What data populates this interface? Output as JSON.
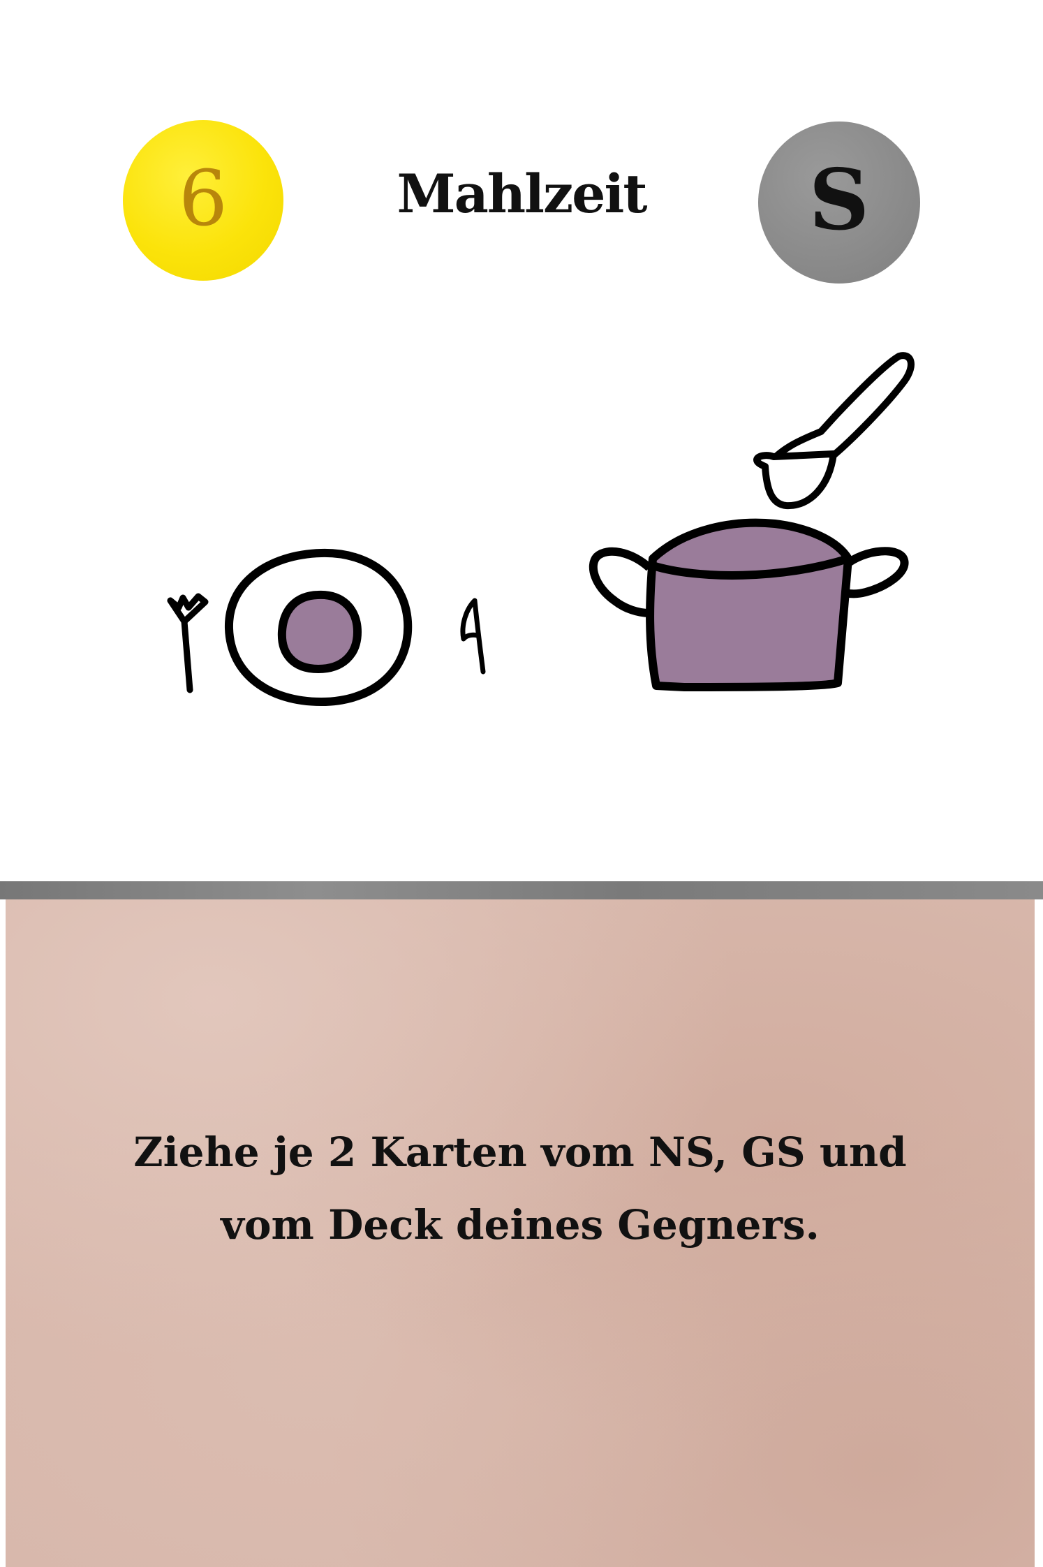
{
  "card": {
    "cost": "6",
    "type": "S",
    "title": "Mahlzeit",
    "effect_text": "Ziehe je 2 Karten vom NS, GS und vom Deck deines Gegners."
  },
  "illustration": {
    "icons": [
      "fork-icon",
      "plate-icon",
      "knife-icon",
      "pot-icon",
      "ladle-icon"
    ],
    "accent_color": "#9a7c9a"
  },
  "colors": {
    "cost_badge": "#fbe30a",
    "cost_text": "#b8860b",
    "type_badge": "#8a8a8a",
    "panel": "#d8b8ac",
    "divider": "#808080"
  }
}
